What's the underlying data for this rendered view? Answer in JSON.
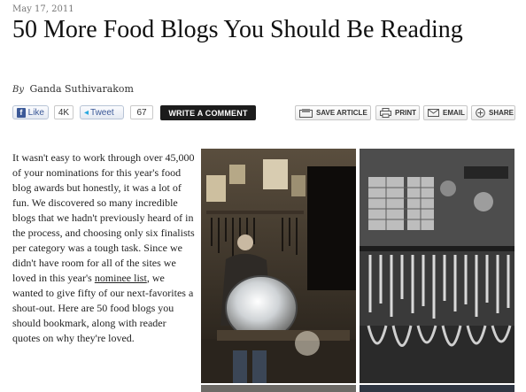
{
  "article": {
    "date": "May 17, 2011",
    "title": "50 More Food Blogs You Should Be Reading",
    "byline_prefix": "By",
    "author": "Ganda Suthivarakom",
    "body_part1": "It wasn't easy to work through over 45,000 of your nominations for this year's food blog awards but honestly, it was a lot of fun. We discovered so many incredible blogs that we hadn't previously heard of in the process, and choosing only six finalists per category was a tough task. Since we didn't have room for all of the sites we loved in this year's ",
    "body_link": "nominee list",
    "body_part2": ", we wanted to give fifty of our next-favorites a shout-out. Here are 50 food blogs you should bookmark, along with reader quotes on why they're loved."
  },
  "social": {
    "like_label": "Like",
    "like_count": "4K",
    "tweet_label": "Tweet",
    "tweet_count": "67",
    "write_comment": "WRITE A COMMENT"
  },
  "actions": {
    "save": "SAVE ARTICLE",
    "print": "PRINT",
    "email": "EMAIL",
    "share": "SHARE"
  },
  "icons": {
    "facebook": "facebook-icon",
    "twitter": "twitter-icon",
    "save": "save-article-icon",
    "print": "printer-icon",
    "email": "envelope-icon",
    "share": "plus-circle-icon"
  },
  "colors": {
    "facebook_blue": "#3b5998",
    "twitter_blue": "#2aa9e0",
    "comment_button": "#1c1c1c"
  }
}
